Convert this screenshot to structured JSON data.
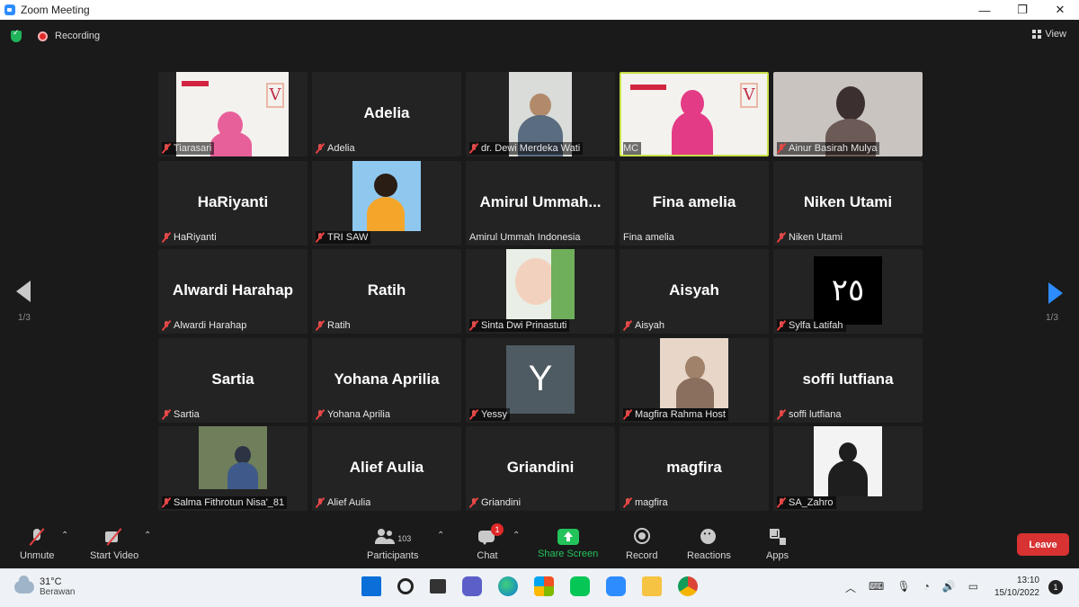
{
  "window": {
    "title": "Zoom Meeting",
    "minimize": "—",
    "restore": "❐",
    "close": "✕"
  },
  "topbar": {
    "recording": "Recording",
    "view": "View"
  },
  "pagination": {
    "left": "1/3",
    "right": "1/3"
  },
  "tiles": [
    {
      "big": "",
      "label": "Tiarasari"
    },
    {
      "big": "Adelia",
      "label": "Adelia"
    },
    {
      "big": "",
      "label": "dr. Dewi Merdeka Wati"
    },
    {
      "big": "",
      "label": "MC"
    },
    {
      "big": "",
      "label": "Ainur Basirah Mulya"
    },
    {
      "big": "HaRiyanti",
      "label": "HaRiyanti"
    },
    {
      "big": "",
      "label": "TRI SAW"
    },
    {
      "big": "Amirul Ummah...",
      "label": "Amirul Ummah Indonesia"
    },
    {
      "big": "Fina amelia",
      "label": "Fina amelia"
    },
    {
      "big": "Niken Utami",
      "label": "Niken Utami"
    },
    {
      "big": "Alwardi Harahap",
      "label": "Alwardi Harahap"
    },
    {
      "big": "Ratih",
      "label": "Ratih"
    },
    {
      "big": "",
      "label": "Sinta Dwi Prinastuti"
    },
    {
      "big": "Aisyah",
      "label": "Aisyah"
    },
    {
      "big": "",
      "label": "Sylfa Latifah",
      "avatar_text": "٢٥"
    },
    {
      "big": "Sartia",
      "label": "Sartia"
    },
    {
      "big": "Yohana Aprilia",
      "label": "Yohana Aprilia"
    },
    {
      "big": "",
      "label": "Yessy",
      "avatar_text": "Y"
    },
    {
      "big": "",
      "label": "Magfira Rahma Host"
    },
    {
      "big": "soffi lutfiana",
      "label": "soffi lutfiana"
    },
    {
      "big": "",
      "label": "Salma Fithrotun Nisa'_81"
    },
    {
      "big": "Alief Aulia",
      "label": "Alief Aulia"
    },
    {
      "big": "Griandini",
      "label": "Griandini"
    },
    {
      "big": "magfira",
      "label": "magfira"
    },
    {
      "big": "",
      "label": "SA_Zahro"
    }
  ],
  "toolbar": {
    "unmute": "Unmute",
    "start_video": "Start Video",
    "participants": "Participants",
    "participants_count": "103",
    "chat": "Chat",
    "chat_badge": "1",
    "share": "Share Screen",
    "record": "Record",
    "reactions": "Reactions",
    "apps": "Apps",
    "leave": "Leave"
  },
  "taskbar": {
    "temp": "31°C",
    "condition": "Berawan",
    "time": "13:10",
    "date": "15/10/2022",
    "notifications": "1"
  },
  "colors": {
    "accent": "#2d8cff",
    "leave": "#d83232",
    "share": "#23c35b",
    "active_speaker": "#c9e04a"
  }
}
